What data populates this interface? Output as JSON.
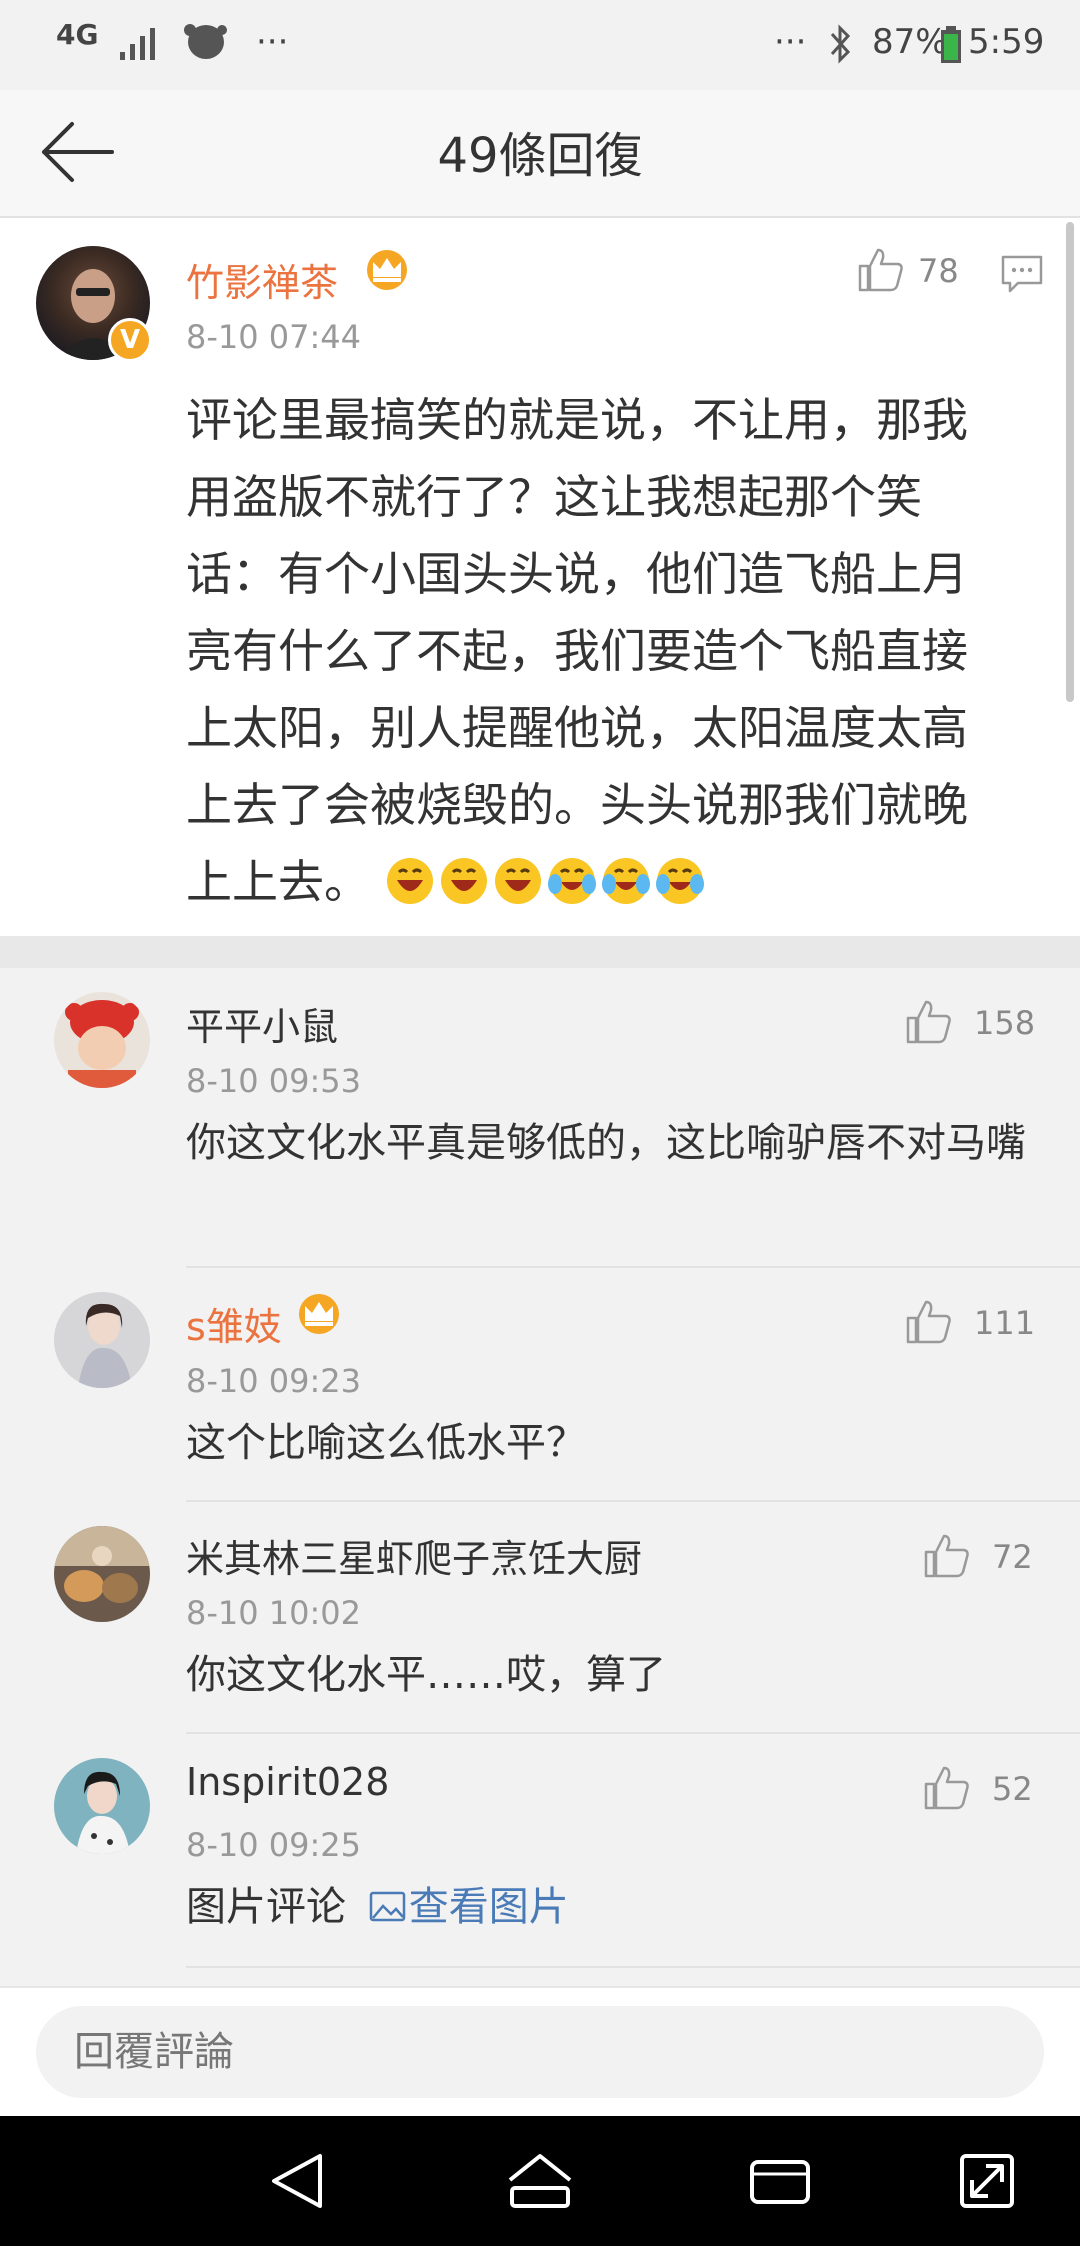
{
  "status_bar": {
    "network": "4G",
    "more_left": "···",
    "more_right": "···",
    "battery": "87%",
    "time": "5:59"
  },
  "header": {
    "title": "49條回復"
  },
  "main_comment": {
    "username": "竹影禅茶",
    "timestamp": "8-10 07:44",
    "likes": "78",
    "verified_badge": "V",
    "text": "评论里最搞笑的就是说，不让用，那我用盗版不就行了？这让我想起那个笑话：有个小国头头说，他们造飞船上月亮有什么了不起，我们要造个飞船直接上太阳，别人提醒他说，太阳温度太高上去了会被烧毁的。头头说那我们就晚上上去。",
    "emojis": [
      "laugh-emoji",
      "laugh-emoji",
      "laugh-emoji",
      "crying-laugh-emoji",
      "crying-laugh-emoji",
      "crying-laugh-emoji"
    ]
  },
  "replies": [
    {
      "username": "平平小鼠",
      "timestamp": "8-10 09:53",
      "likes": "158",
      "text": "你这文化水平真是够低的，这比喻驴唇不对马嘴"
    },
    {
      "username": "s雏妓",
      "timestamp": "8-10 09:23",
      "likes": "111",
      "text": "这个比喻这么低水平？"
    },
    {
      "username": "米其林三星虾爬子烹饪大厨",
      "timestamp": "8-10 10:02",
      "likes": "72",
      "text": "你这文化水平……哎，算了"
    },
    {
      "username": "Inspirit028",
      "timestamp": "8-10 09:25",
      "likes": "52",
      "text": "图片评论",
      "link": "查看图片"
    }
  ],
  "footer": {
    "reply_placeholder": "回覆評論"
  },
  "colors": {
    "vip_name": "#eb7340",
    "link": "#4a7bb7",
    "crown": "#f5a623"
  }
}
